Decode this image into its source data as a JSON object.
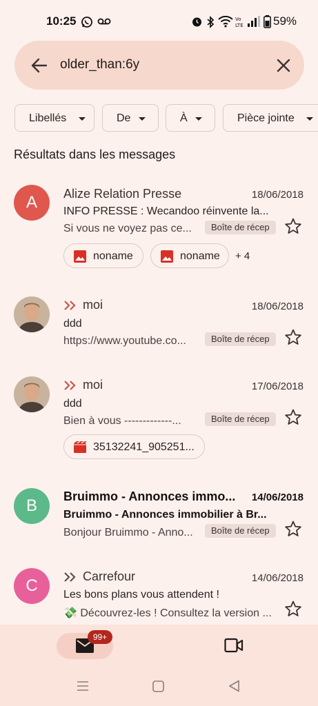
{
  "status_bar": {
    "time": "10:25",
    "battery": "59%"
  },
  "search": {
    "query": "older_than:6y"
  },
  "filters": [
    {
      "label": "Libellés"
    },
    {
      "label": "De"
    },
    {
      "label": "À"
    },
    {
      "label": "Pièce jointe"
    }
  ],
  "section_title": "Résultats dans les messages",
  "messages": [
    {
      "sender": "Alize Relation Presse",
      "avatar_letter": "A",
      "avatar_color": "#e0574e",
      "date": "18/06/2018",
      "subject": "INFO PRESSE : Wecandoo réinvente la...",
      "snippet": "Si vous ne voyez pas ce...",
      "label": "Boîte de récep",
      "attachments": [
        "noname",
        "noname"
      ],
      "more_attachments": "+ 4"
    },
    {
      "sender": "moi",
      "date": "18/06/2018",
      "subject": "ddd",
      "snippet": "https://www.youtube.co...",
      "label": "Boîte de récep"
    },
    {
      "sender": "moi",
      "date": "17/06/2018",
      "subject": "ddd",
      "snippet": "Bien à vous -------------...",
      "label": "Boîte de récep",
      "attachments": [
        "35132241_905251..."
      ]
    },
    {
      "sender": "Bruimmo - Annonces immo...",
      "avatar_letter": "B",
      "avatar_color": "#5cb98a",
      "date": "14/06/2018",
      "subject": "Bruimmo - Annonces immobilier à Br...",
      "snippet": "Bonjour Bruimmo - Anno...",
      "label": "Boîte de récep"
    },
    {
      "sender": "Carrefour",
      "avatar_letter": "C",
      "avatar_color": "#e8609a",
      "date": "14/06/2018",
      "subject": "Les bons plans vous attendent !",
      "snippet": "💸 Découvrez-les ! Consultez la version ..."
    }
  ],
  "bottom_nav": {
    "mail_badge": "99+"
  }
}
